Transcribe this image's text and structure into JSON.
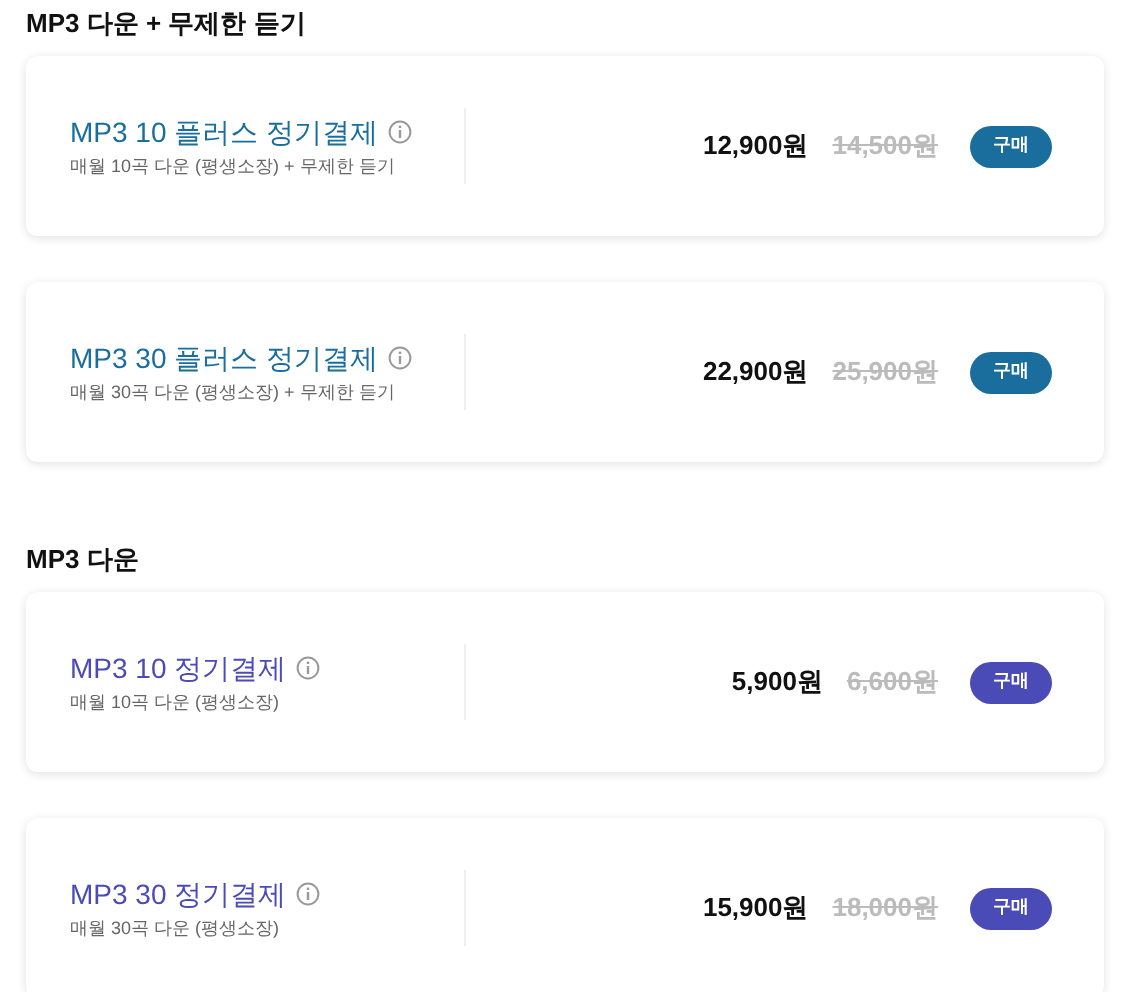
{
  "sections": [
    {
      "title": "MP3 다운 + 무제한 듣기",
      "color": "#1a6e9e",
      "plans": [
        {
          "name": "MP3 10 플러스 정기결제",
          "description": "매월 10곡 다운 (평생소장) + 무제한 듣기",
          "price": "12,900원",
          "original_price": "14,500원",
          "button": "구매"
        },
        {
          "name": "MP3 30 플러스 정기결제",
          "description": "매월 30곡 다운 (평생소장) + 무제한 듣기",
          "price": "22,900원",
          "original_price": "25,900원",
          "button": "구매"
        }
      ]
    },
    {
      "title": "MP3 다운",
      "color": "#4b4bb8",
      "plans": [
        {
          "name": "MP3 10 정기결제",
          "description": "매월 10곡 다운 (평생소장)",
          "price": "5,900원",
          "original_price": "6,600원",
          "button": "구매"
        },
        {
          "name": "MP3 30 정기결제",
          "description": "매월 30곡 다운 (평생소장)",
          "price": "15,900원",
          "original_price": "18,000원",
          "button": "구매"
        }
      ]
    }
  ]
}
